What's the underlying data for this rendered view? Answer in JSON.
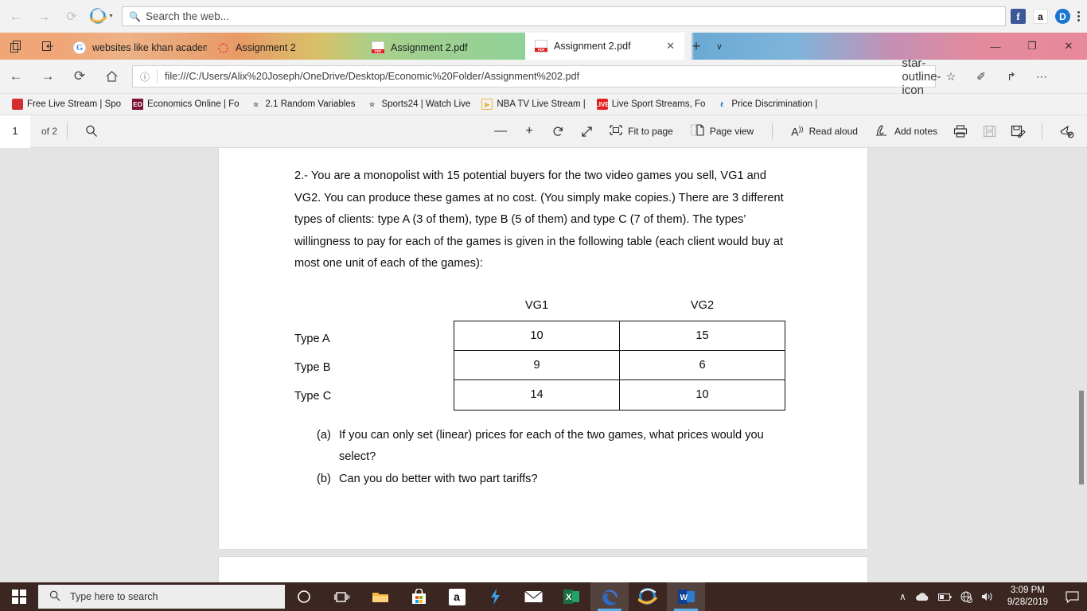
{
  "browser": {
    "search": {
      "placeholder": "Search the web...",
      "icon": "search-icon"
    },
    "nav": {
      "back": "←",
      "forward": "→",
      "refresh": "⟳",
      "home": "⌂"
    },
    "top_icons": [
      {
        "name": "facebook-icon",
        "label": "f"
      },
      {
        "name": "amazon-icon",
        "label": "a"
      },
      {
        "name": "disconnect-icon",
        "label": "D"
      }
    ],
    "more_menu": "more-options-icon",
    "tabs": [
      {
        "title": "websites like khan academy",
        "favicon": "google-icon",
        "active": false
      },
      {
        "title": "Assignment 2",
        "favicon": "loading-spinner-icon",
        "active": false
      },
      {
        "title": "Assignment 2.pdf",
        "favicon": "pdf-icon",
        "active": false
      },
      {
        "title": "Assignment 2.pdf",
        "favicon": "pdf-icon",
        "active": true
      }
    ],
    "tab_close": "✕",
    "new_tab": "+",
    "tab_chevron": "∨",
    "window_controls": {
      "minimize": "—",
      "maximize": "❐",
      "close": "✕"
    },
    "address": {
      "url": "file:///C:/Users/Alix%20Joseph/OneDrive/Desktop/Economic%20Folder/Assignment%202.pdf",
      "info_icon": "info-icon",
      "favorite_icon": "star-outline-icon"
    },
    "right_icons": [
      {
        "name": "favorites-hub-icon",
        "glyph": "☆"
      },
      {
        "name": "notes-pen-icon",
        "glyph": "✐"
      },
      {
        "name": "share-icon",
        "glyph": "↱"
      },
      {
        "name": "settings-more-icon",
        "glyph": "⋯"
      }
    ],
    "favorites": [
      {
        "label": "Free Live Stream | Spo",
        "icon": "tv-icon",
        "icon_class": "fi-tv",
        "glyph": ""
      },
      {
        "label": "Economics Online | Fo",
        "icon": "eo-icon",
        "icon_class": "fi-eo",
        "glyph": "EO"
      },
      {
        "label": "2.1 Random Variables",
        "icon": "star-icon",
        "icon_class": "fi-star",
        "glyph": "☆"
      },
      {
        "label": "Sports24 | Watch Live",
        "icon": "star-icon",
        "icon_class": "fi-star",
        "glyph": "☆"
      },
      {
        "label": "NBA TV Live Stream |",
        "icon": "play-icon",
        "icon_class": "fi-nba",
        "glyph": "▶"
      },
      {
        "label": "Live Sport Streams, Fo",
        "icon": "live-icon",
        "icon_class": "fi-live",
        "glyph": "LIVE"
      },
      {
        "label": "Price Discrimination |",
        "icon": "bar-icon",
        "icon_class": "fi-bar",
        "glyph": "ℓ"
      }
    ]
  },
  "pdf_toolbar": {
    "page_number": "1",
    "page_total": "of 2",
    "search_icon": "search-icon",
    "zoom_out": "—",
    "zoom_in": "+",
    "rotate": "↻",
    "fullscreen": "↗",
    "fit_to_page": "Fit to page",
    "page_view": "Page view",
    "read_aloud": "Read aloud",
    "add_notes": "Add notes",
    "print_icon": "print-icon",
    "save_icon": "save-icon",
    "save_as_icon": "save-as-icon",
    "pin_icon": "unpin-icon"
  },
  "document": {
    "question": "2.- You are a monopolist with 15 potential buyers for the two video games you sell, VG1 and VG2. You can produce these games at no cost. (You simply make copies.) There are 3 different types of clients: type A (3 of them), type B (5 of them) and type C (7 of them). The types’ willingness to pay for each of the games is given in the following table (each client would buy at most one unit of each of the games):",
    "table": {
      "columns": [
        "VG1",
        "VG2"
      ],
      "row_labels": [
        "Type A",
        "Type B",
        "Type C"
      ],
      "rows": [
        [
          "10",
          "15"
        ],
        [
          "9",
          "6"
        ],
        [
          "14",
          "10"
        ]
      ]
    },
    "parts": [
      {
        "label": "(a)",
        "text": "If you can only set (linear) prices for each of the two games, what prices would you select?"
      },
      {
        "label": "(b)",
        "text": "Can you do better with two part tariffs?"
      }
    ]
  },
  "taskbar": {
    "start": "start-button",
    "search_placeholder": "Type here to search",
    "search_icon": "search-icon",
    "apps": [
      {
        "name": "cortana-icon",
        "glyph": "○",
        "active": false
      },
      {
        "name": "task-view-icon",
        "glyph": "⌸",
        "active": false
      },
      {
        "name": "file-explorer-icon",
        "glyph": "🗀",
        "active": false
      },
      {
        "name": "microsoft-store-icon",
        "glyph": "🛍",
        "active": false
      },
      {
        "name": "amazon-icon",
        "glyph": "a",
        "active": false
      },
      {
        "name": "lightning-app-icon",
        "glyph": "⚡",
        "active": false
      },
      {
        "name": "mail-icon",
        "glyph": "✉",
        "active": false
      },
      {
        "name": "excel-icon",
        "glyph": "X",
        "active": false
      },
      {
        "name": "microsoft-edge-icon",
        "glyph": "e",
        "active": true
      },
      {
        "name": "internet-explorer-icon",
        "glyph": "e",
        "active": false
      },
      {
        "name": "word-icon",
        "glyph": "W",
        "active": true
      }
    ],
    "tray": [
      {
        "name": "show-hidden-icons-icon",
        "glyph": "∧"
      },
      {
        "name": "onedrive-icon",
        "glyph": "☁"
      },
      {
        "name": "battery-icon",
        "glyph": "□"
      },
      {
        "name": "network-no-internet-icon",
        "glyph": "⊕"
      },
      {
        "name": "volume-icon",
        "glyph": "🔊"
      }
    ],
    "time": "3:09 PM",
    "date": "9/28/2019",
    "notifications_icon": "action-center-icon"
  }
}
